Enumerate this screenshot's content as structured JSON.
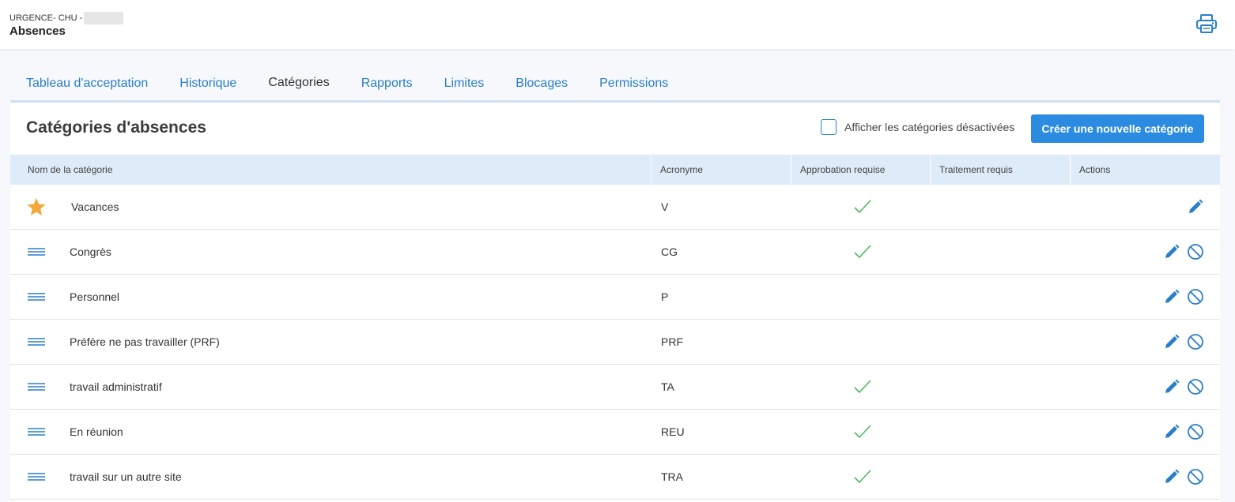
{
  "header": {
    "org": "URGENCE- CHU -",
    "title": "Absences",
    "print_icon": "printer-icon"
  },
  "tabs": [
    {
      "label": "Tableau d'acceptation",
      "active": false
    },
    {
      "label": "Historique",
      "active": false
    },
    {
      "label": "Catégories",
      "active": true
    },
    {
      "label": "Rapports",
      "active": false
    },
    {
      "label": "Limites",
      "active": false
    },
    {
      "label": "Blocages",
      "active": false
    },
    {
      "label": "Permissions",
      "active": false
    }
  ],
  "panel": {
    "title": "Catégories d'absences",
    "show_disabled_label": "Afficher les catégories désactivées",
    "show_disabled_checked": false,
    "create_button": "Créer une nouvelle catégorie"
  },
  "table": {
    "columns": [
      "Nom de la catégorie",
      "Acronyme",
      "Approbation requise",
      "Traitement requis",
      "Actions"
    ],
    "rows": [
      {
        "name": "Vacances",
        "acronym": "V",
        "approval": true,
        "treatment": false,
        "lead_icon": "star-icon",
        "can_disable": false
      },
      {
        "name": "Congrès",
        "acronym": "CG",
        "approval": true,
        "treatment": false,
        "lead_icon": "drag-handle-icon",
        "can_disable": true
      },
      {
        "name": "Personnel",
        "acronym": "P",
        "approval": false,
        "treatment": false,
        "lead_icon": "drag-handle-icon",
        "can_disable": true
      },
      {
        "name": "Préfère ne pas travailler (PRF)",
        "acronym": "PRF",
        "approval": false,
        "treatment": false,
        "lead_icon": "drag-handle-icon",
        "can_disable": true
      },
      {
        "name": "travail administratif",
        "acronym": "TA",
        "approval": true,
        "treatment": false,
        "lead_icon": "drag-handle-icon",
        "can_disable": true
      },
      {
        "name": "En réunion",
        "acronym": "REU",
        "approval": true,
        "treatment": false,
        "lead_icon": "drag-handle-icon",
        "can_disable": true
      },
      {
        "name": "travail sur un autre site",
        "acronym": "TRA",
        "approval": true,
        "treatment": false,
        "lead_icon": "drag-handle-icon",
        "can_disable": true
      }
    ]
  },
  "colors": {
    "accent": "#2a7ec8",
    "button": "#2b8be0",
    "header_bg": "#deebf8",
    "check": "#4cbb5e",
    "star": "#f2a93b"
  }
}
